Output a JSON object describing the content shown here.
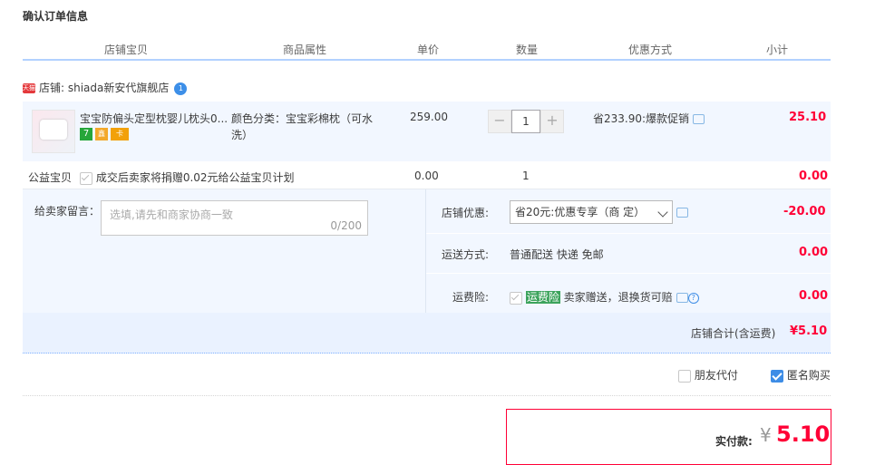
{
  "title": "确认订单信息",
  "headers": [
    "店铺宝贝",
    "商品属性",
    "单价",
    "数量",
    "优惠方式",
    "小计"
  ],
  "shop": {
    "badge": "天猫",
    "prefix": "店铺: ",
    "name": "shiada新安代旗舰店",
    "ww_icon": "wangwang-icon"
  },
  "item": {
    "title": "宝宝防偏头定型枕婴儿枕头0...",
    "attr": "颜色分类：宝宝彩棉枕（可水洗）",
    "price": "259.00",
    "qty": "1",
    "qty_minus": "−",
    "qty_plus": "+",
    "promo": "省233.90:爆款促销",
    "subtotal": "25.10",
    "badges": [
      "7",
      "鑫",
      "卡"
    ]
  },
  "charity": {
    "label": "公益宝贝",
    "text": "成交后卖家将捐赠0.02元给公益宝贝计划",
    "price": "0.00",
    "qty": "1",
    "subtotal": "0.00"
  },
  "message": {
    "label": "给卖家留言：",
    "placeholder": "选填,请先和商家协商一致",
    "counter": "0/200"
  },
  "coupon": {
    "label": "店铺优惠:",
    "selected": "省20元:优惠专享（商 定）",
    "amount": "-20.00"
  },
  "shipping": {
    "label": "运送方式:",
    "value": "普通配送 快递 免邮",
    "amount": "0.00"
  },
  "insurance": {
    "label": "运费险:",
    "tag": "运费险",
    "text": "卖家赠送，退换货可赔",
    "help": "?",
    "amount": "0.00"
  },
  "shop_total": {
    "label": "店铺合计(含运费)",
    "value": "¥5.10"
  },
  "options": {
    "friend_pay": "朋友代付",
    "anonymous": "匿名购买"
  },
  "pay": {
    "label": "实付款:",
    "currency": "¥",
    "value": "5.10"
  },
  "colors": {
    "accent": "#ff0036",
    "header_border": "#b2d1ff",
    "row_bg": "#f2f7ff",
    "checkbox_blue": "#3e8de6"
  }
}
